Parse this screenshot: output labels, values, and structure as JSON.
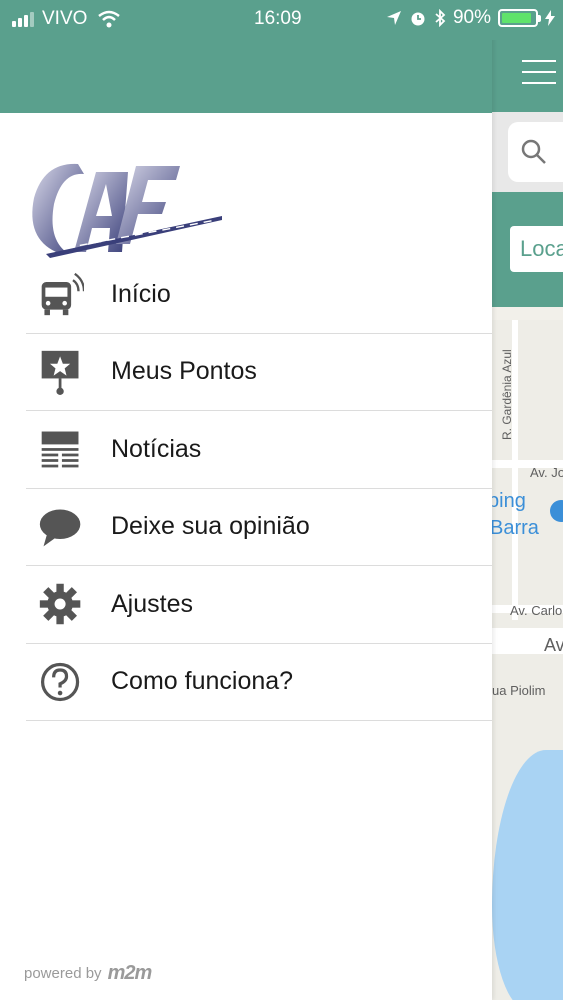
{
  "status_bar": {
    "carrier": "VIVO",
    "time": "16:09",
    "battery_percent": "90%",
    "battery_level": 0.9,
    "icons": [
      "signal-icon",
      "wifi-icon",
      "location-arrow-icon",
      "alarm-icon",
      "bluetooth-icon",
      "battery-icon",
      "charging-icon"
    ]
  },
  "drawer": {
    "logo_text": "CAF",
    "menu": [
      {
        "label": "Início",
        "icon": "bus-icon"
      },
      {
        "label": "Meus Pontos",
        "icon": "star-sign-icon"
      },
      {
        "label": "Notícias",
        "icon": "newspaper-icon"
      },
      {
        "label": "Deixe sua opinião",
        "icon": "speech-bubble-icon"
      },
      {
        "label": "Ajustes",
        "icon": "gear-icon"
      },
      {
        "label": "Como funciona?",
        "icon": "question-icon"
      }
    ],
    "footer": {
      "powered_by": "powered by",
      "brand": "m2m"
    }
  },
  "background_app": {
    "location_button": "Loca",
    "map_labels": {
      "street_vertical": "R. Gardênia Azul",
      "av_jo": "Av. Jo",
      "shopping": "ping",
      "barra": "Barra",
      "av_carlo": "Av. Carlo",
      "av": "Av",
      "piolim": "ua Piolim"
    }
  },
  "colors": {
    "accent": "#5aa08d",
    "icon_gray": "#555555",
    "divider": "#dcdcdc",
    "lake": "#a9d3f3"
  }
}
